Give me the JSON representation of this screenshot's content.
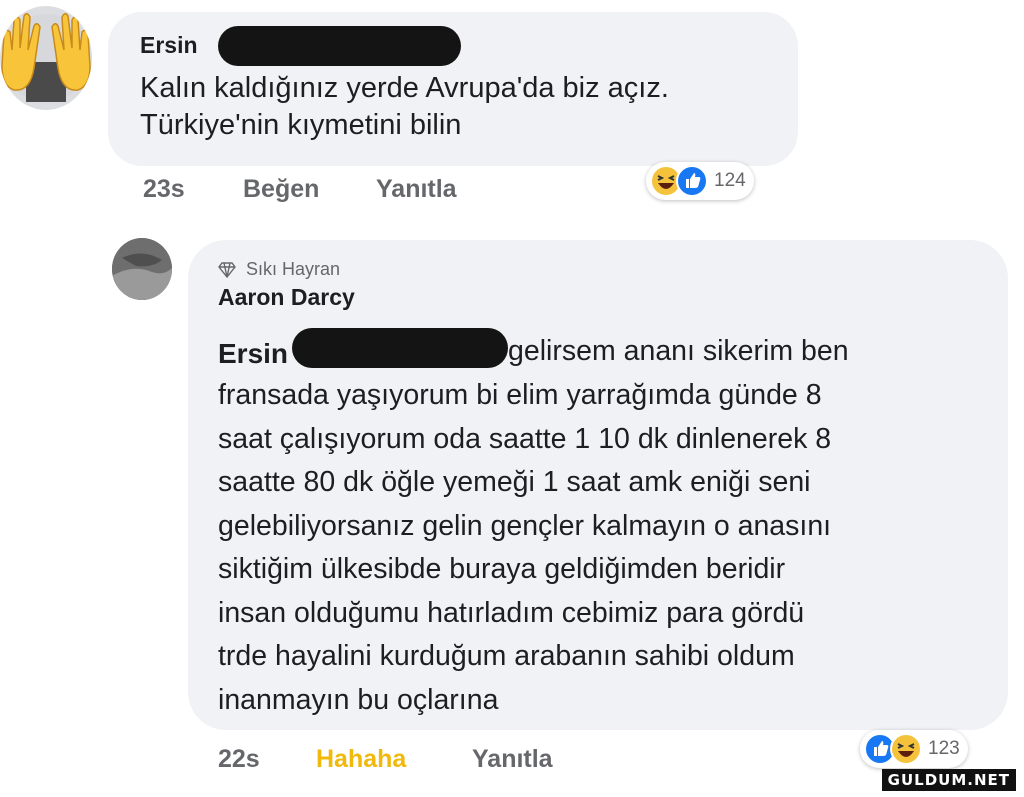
{
  "comment1": {
    "author": "Ersin",
    "text": "Kalın kaldığınız yerde Avrupa'da biz açız.\nTürkiye'nin kıymetini bilin",
    "time": "23s",
    "like_label": "Beğen",
    "reply_label": "Yanıtla",
    "reaction_count": "124",
    "reactions": [
      "haha-icon",
      "like-icon"
    ],
    "avatar_icon": "raised-hands-icon"
  },
  "comment2": {
    "badge": "Sıkı Hayran",
    "badge_icon": "diamond-icon",
    "author": "Aaron Darcy",
    "mention": "Ersin",
    "text_first": "gelirsem ananı sikerim ben",
    "text_rest": "fransada yaşıyorum bi elim yarrağımda günde 8\nsaat çalışıyorum oda saatte 1 10 dk dinlenerek 8\nsaatte 80 dk öğle yemeği 1 saat amk eniği seni\ngelebiliyorsanız gelin gençler kalmayın o anasını\nsiktiğim ülkesibde buraya geldiğimden beridir\ninsan olduğumu hatırladım cebimiz para gördü\ntrde hayalini kurduğum arabanın sahibi oldum\ninanmayın bu oçlarına",
    "time": "22s",
    "like_label": "Hahaha",
    "reply_label": "Yanıtla",
    "reaction_count": "123",
    "reactions": [
      "like-icon",
      "haha-icon"
    ]
  },
  "watermark": "GULDUM.NET",
  "colors": {
    "bubble": "#f0f2f5",
    "meta_text": "#65676b",
    "haha_reaction": "#f0b90b",
    "like_blue": "#1877f2"
  }
}
